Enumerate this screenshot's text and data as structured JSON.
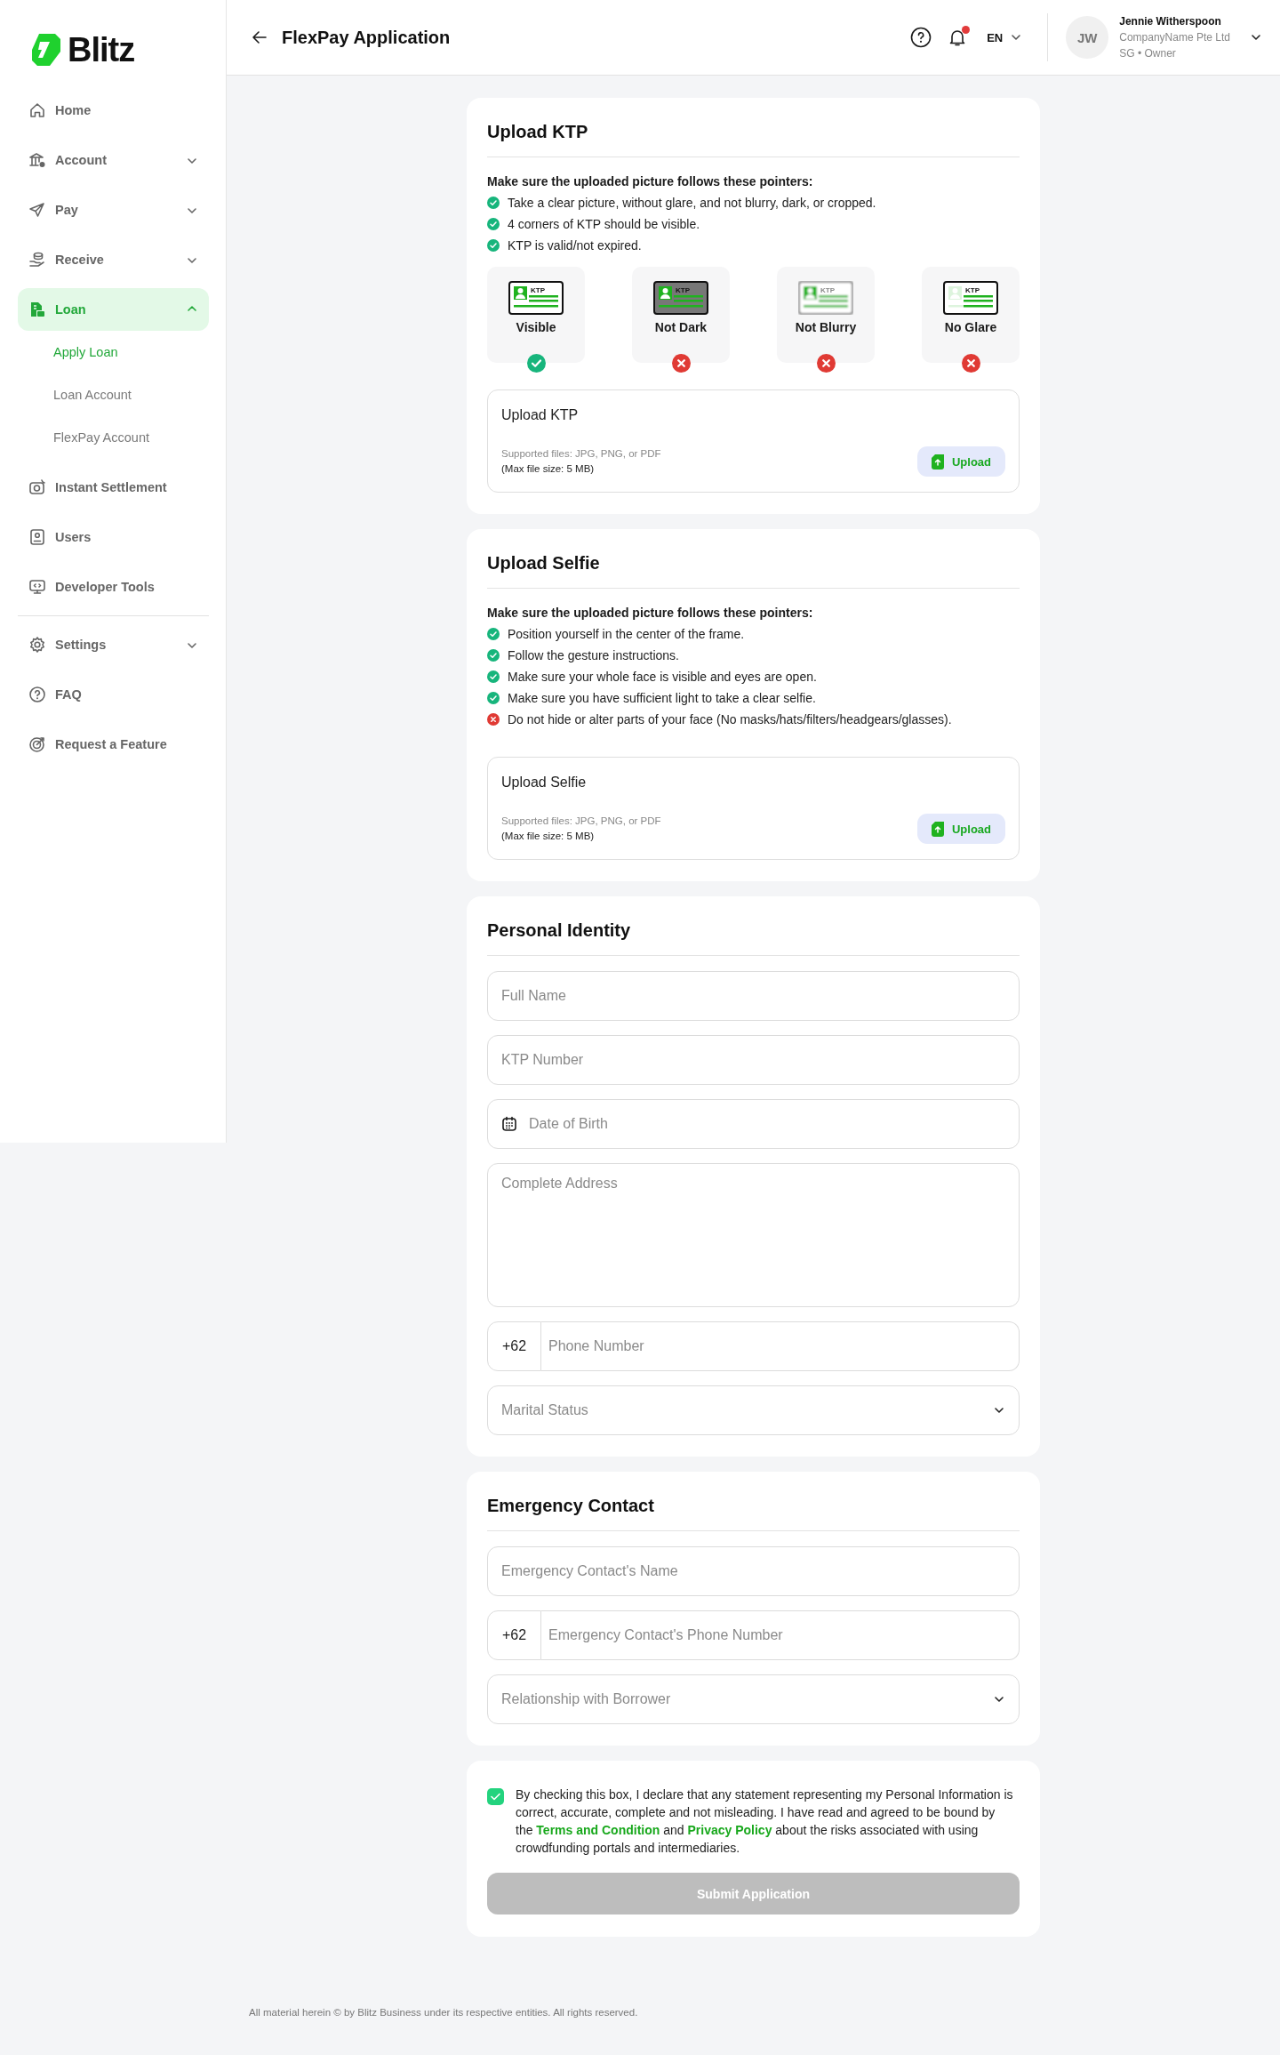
{
  "brand": {
    "name": "Blitz"
  },
  "sidebar": {
    "main_items": [
      {
        "label": "Home",
        "selected": false
      },
      {
        "label": "Account",
        "expanded": false,
        "selected": false
      },
      {
        "label": "Pay",
        "expanded": false,
        "selected": false
      },
      {
        "label": "Receive",
        "expanded": false,
        "selected": false
      },
      {
        "label": "Loan",
        "expanded": true,
        "selected": true,
        "children": [
          {
            "label": "Apply Loan",
            "selected": true
          },
          {
            "label": "Loan Account",
            "selected": false
          },
          {
            "label": "FlexPay Account",
            "selected": false
          }
        ]
      },
      {
        "label": "Instant Settlement",
        "selected": false
      },
      {
        "label": "Users",
        "selected": false
      },
      {
        "label": "Developer Tools",
        "selected": false
      }
    ],
    "bottom_items": [
      {
        "label": "Settings",
        "expanded": false,
        "selected": false
      },
      {
        "label": "FAQ",
        "selected": false
      },
      {
        "label": "Request a Feature",
        "selected": false
      }
    ]
  },
  "header": {
    "title": "FlexPay Application",
    "notification_dot": true,
    "language": "EN",
    "user": {
      "initials": "JW",
      "name": "Jennie Witherspoon",
      "company": "CompanyName Pte Ltd",
      "role": "SG • Owner"
    }
  },
  "upload_ktp": {
    "title": "Upload KTP",
    "pointers_heading": "Make sure the uploaded picture follows these pointers:",
    "pointers": [
      {
        "text": "Take a clear picture, without glare, and not blurry, dark, or cropped.",
        "ok": true
      },
      {
        "text": "4 corners of KTP should be visible.",
        "ok": true
      },
      {
        "text": "KTP is valid/not expired.",
        "ok": true
      }
    ],
    "examples": [
      {
        "label": "Visible",
        "card_text": "KTP",
        "kind": "clear",
        "ok": true
      },
      {
        "label": "Not Dark",
        "card_text": "KTP",
        "kind": "dark",
        "ok": false
      },
      {
        "label": "Not Blurry",
        "card_text": "KTP",
        "kind": "blurry",
        "ok": false
      },
      {
        "label": "No Glare",
        "card_text": "KTP",
        "kind": "glare",
        "ok": false
      }
    ],
    "upload": {
      "label": "Upload KTP",
      "hint": "Supported files: JPG, PNG, or PDF",
      "limit": "(Max file size: 5 MB)",
      "button": "Upload"
    }
  },
  "upload_selfie": {
    "title": "Upload Selfie",
    "pointers_heading": "Make sure the uploaded picture follows these pointers:",
    "pointers": [
      {
        "text": "Position yourself in the center of the frame.",
        "ok": true
      },
      {
        "text": "Follow the gesture instructions.",
        "ok": true
      },
      {
        "text": "Make sure your whole face is visible and eyes are open.",
        "ok": true
      },
      {
        "text": "Make sure you have sufficient light to take a clear selfie.",
        "ok": true
      },
      {
        "text": "Do not hide or alter parts of your face (No masks/hats/filters/headgears/glasses).",
        "ok": false
      }
    ],
    "upload": {
      "label": "Upload Selfie",
      "hint": "Supported files: JPG, PNG, or PDF",
      "limit": "(Max file size: 5 MB)",
      "button": "Upload"
    }
  },
  "personal_identity": {
    "title": "Personal Identity",
    "fields": [
      {
        "kind": "text",
        "placeholder": "Full Name"
      },
      {
        "kind": "text",
        "placeholder": "KTP Number"
      },
      {
        "kind": "date",
        "placeholder": "Date of Birth"
      },
      {
        "kind": "textarea",
        "placeholder": "Complete Address"
      },
      {
        "kind": "phone",
        "prefix": "+62",
        "placeholder": "Phone Number"
      },
      {
        "kind": "select",
        "placeholder": "Marital Status"
      }
    ]
  },
  "emergency_contact": {
    "title": "Emergency Contact",
    "fields": [
      {
        "kind": "text",
        "placeholder": "Emergency Contact's Name"
      },
      {
        "kind": "phone",
        "prefix": "+62",
        "placeholder": "Emergency Contact's Phone Number"
      },
      {
        "kind": "select",
        "placeholder": "Relationship with Borrower"
      }
    ]
  },
  "consent": {
    "checked": true,
    "segments": [
      {
        "kind": "text",
        "text": "By checking this box, I declare that any statement representing my Personal Information is correct, accurate, complete and not misleading. I have read and agreed to be bound by the "
      },
      {
        "kind": "link",
        "text": "Terms and Condition"
      },
      {
        "kind": "text",
        "text": " and "
      },
      {
        "kind": "link",
        "text": "Privacy Policy"
      },
      {
        "kind": "text",
        "text": " about the risks associated with using crowdfunding portals and intermediaries."
      }
    ],
    "submit": {
      "label": "Submit Application",
      "disabled": true
    }
  },
  "footer": {
    "text": "All material herein © by Blitz Business under its respective entities. All rights reserved."
  }
}
